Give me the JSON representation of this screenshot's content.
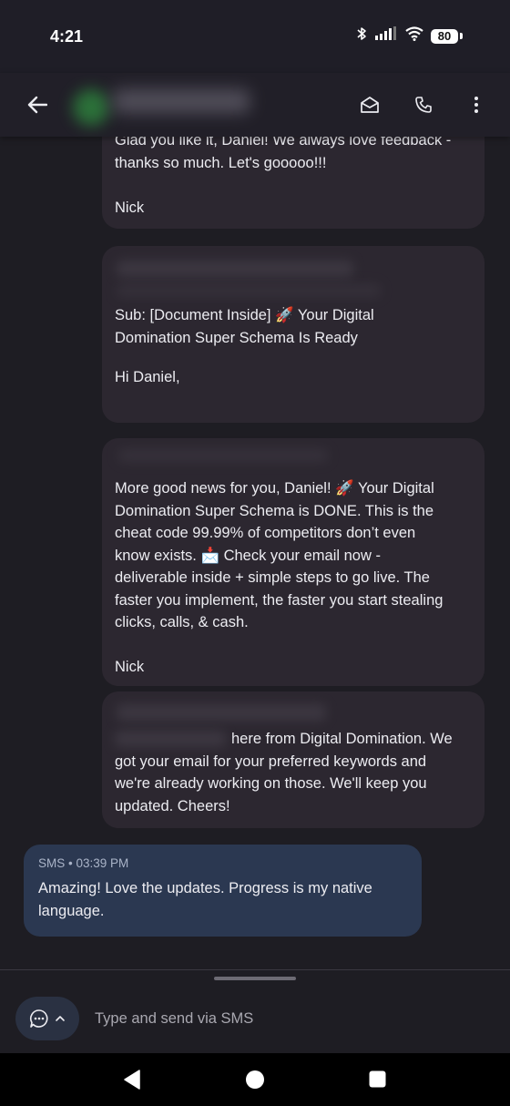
{
  "status_bar": {
    "time": "4:21",
    "battery": "80"
  },
  "messages": {
    "m1": {
      "lines": [
        "Glad you like it, Daniel! We always love feedback -",
        "thanks so much. Let's gooooo!!!"
      ],
      "signature": "Nick"
    },
    "m2": {
      "lines": [
        "Sub: [Document Inside] 🚀 Your Digital",
        "Domination Super Schema Is Ready"
      ],
      "greeting": "Hi Daniel,"
    },
    "m3": {
      "lines": [
        "More good news for you, Daniel! 🚀 Your Digital",
        "Domination Super Schema is DONE. This is the",
        "cheat code 99.99% of competitors don’t even",
        "know exists. 📩 Check your email now -",
        "deliverable inside + simple steps to go live. The",
        "faster you implement, the faster you start stealing",
        "clicks, calls, & cash."
      ],
      "signature": "Nick"
    },
    "m4": {
      "lines": [
        "here from Digital Domination. We",
        "got your email for your preferred keywords and",
        "we're already working on those. We'll keep you",
        "updated. Cheers!"
      ]
    }
  },
  "outgoing": {
    "meta": "SMS • 03:39 PM",
    "lines": [
      "Amazing! Love the updates. Progress is my native",
      "language."
    ]
  },
  "composer": {
    "placeholder": "Type and send via SMS"
  },
  "colors": {
    "incoming_bubble": "#2c2730",
    "outgoing_bubble": "#2b3851",
    "background": "#1e1d23"
  }
}
